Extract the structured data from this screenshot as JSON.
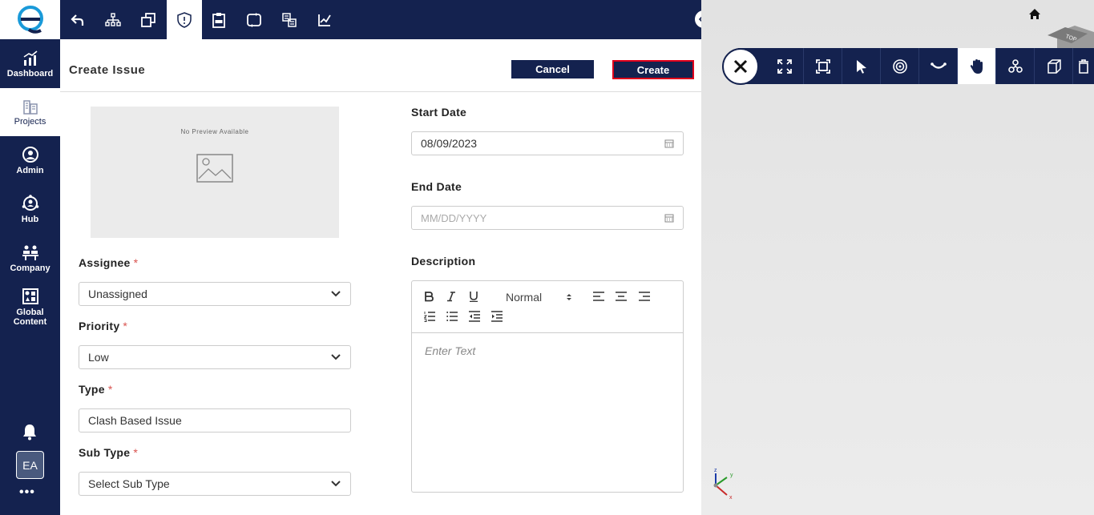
{
  "nav": {
    "items": [
      {
        "label": "Dashboard",
        "icon": "dashboard-chart-icon"
      },
      {
        "label": "Projects",
        "icon": "building-icon"
      },
      {
        "label": "Admin",
        "icon": "admin-user-icon"
      },
      {
        "label": "Hub",
        "icon": "hub-icon"
      },
      {
        "label": "Company",
        "icon": "company-icon"
      },
      {
        "label": "Global Content",
        "icon": "global-content-icon"
      }
    ],
    "avatar_initials": "EA",
    "more": "•••"
  },
  "form": {
    "title": "Create Issue",
    "cancel_label": "Cancel",
    "create_label": "Create",
    "preview_text": "No Preview Available",
    "assignee": {
      "label": "Assignee",
      "required": "*",
      "value": "Unassigned"
    },
    "priority": {
      "label": "Priority",
      "required": "*",
      "value": "Low"
    },
    "type": {
      "label": "Type",
      "required": "*",
      "value": "Clash Based Issue"
    },
    "subtype": {
      "label": "Sub Type",
      "required": "*",
      "value": "Select Sub Type"
    },
    "start_date": {
      "label": "Start Date",
      "value": "08/09/2023"
    },
    "end_date": {
      "label": "End Date",
      "placeholder": "MM/DD/YYYY"
    },
    "description": {
      "label": "Description",
      "format": "Normal",
      "placeholder": "Enter Text"
    }
  },
  "viewer": {
    "cube_label": "TOP",
    "axes": {
      "x": "x",
      "y": "y",
      "z": "z"
    }
  },
  "colors": {
    "primary": "#14224f",
    "accent": "#e0001b",
    "required": "#d9534f"
  }
}
